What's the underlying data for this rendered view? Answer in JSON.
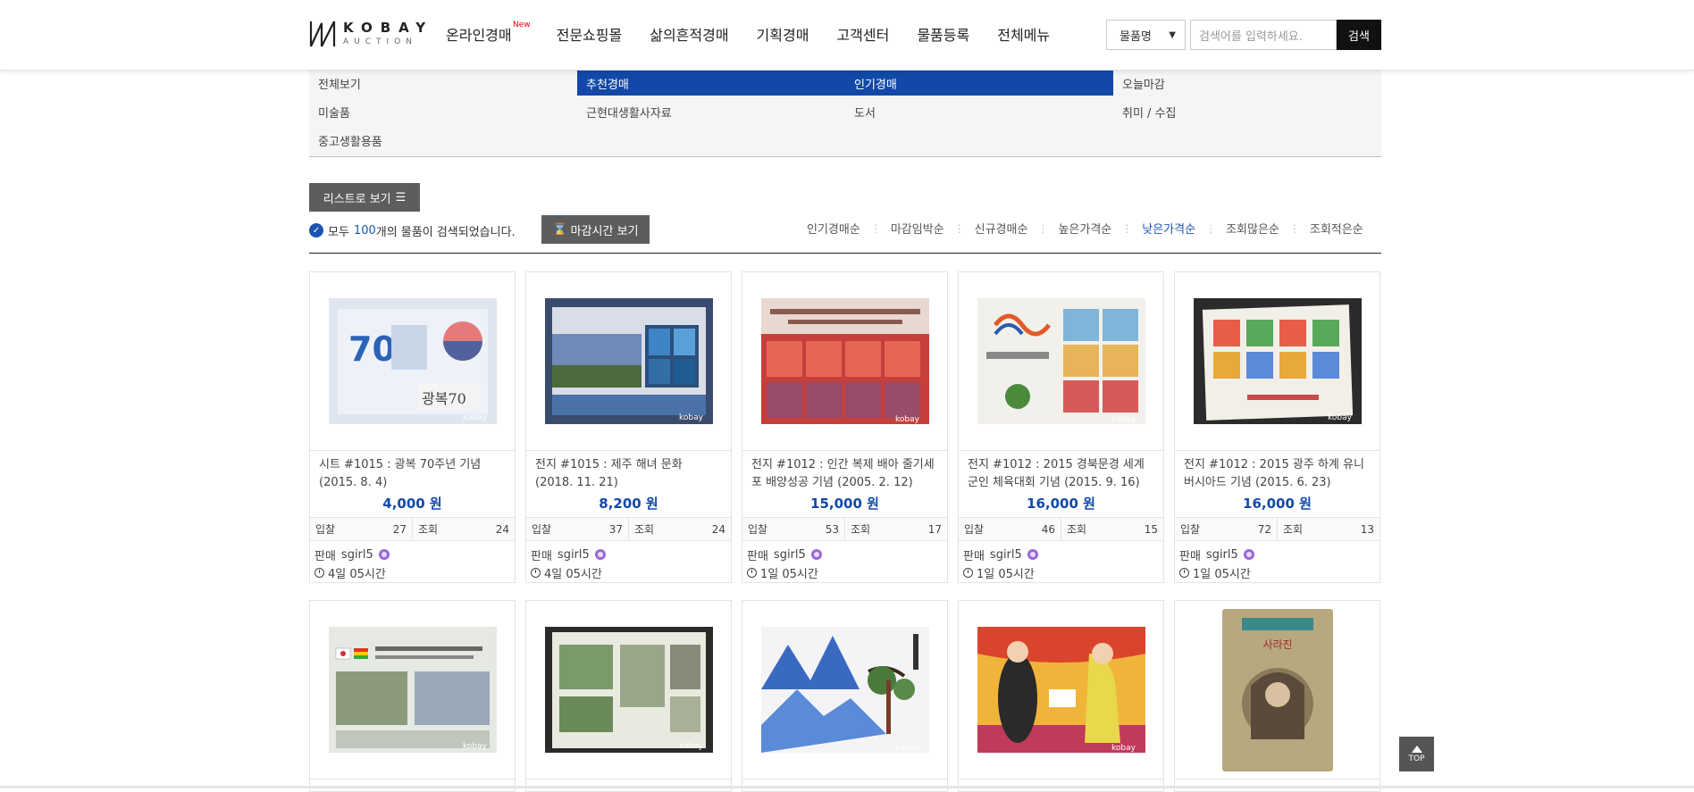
{
  "brand": {
    "name": "KOBAY",
    "sub": "AUCTION"
  },
  "gnb": {
    "items": [
      {
        "label": "온라인경매",
        "badge": "New"
      },
      {
        "label": "전문쇼핑몰"
      },
      {
        "label": "삶의흔적경매"
      },
      {
        "label": "기획경매"
      },
      {
        "label": "고객센터"
      },
      {
        "label": "물품등록"
      },
      {
        "label": "전체메뉴"
      }
    ]
  },
  "search": {
    "select_value": "물품명",
    "placeholder": "검색어를 입력하세요.",
    "button": "검색"
  },
  "categories": [
    {
      "label": "전체보기",
      "active": false
    },
    {
      "label": "추천경매",
      "active": true
    },
    {
      "label": "인기경매",
      "active": true
    },
    {
      "label": "오늘마감",
      "active": false
    },
    {
      "label": "미술품",
      "active": false
    },
    {
      "label": "근현대생활사자료",
      "active": false
    },
    {
      "label": "도서",
      "active": false
    },
    {
      "label": "취미 / 수집",
      "active": false
    },
    {
      "label": "중고생활용품",
      "active": false
    }
  ],
  "toolbar": {
    "list_view": "리스트로 보기",
    "count_prefix": "모두",
    "count_num": "100",
    "count_suffix": "개의 물품이 검색되었습니다.",
    "deadline_view": "마감시간 보기"
  },
  "sorts": [
    {
      "label": "인기경매순",
      "active": false
    },
    {
      "label": "마감임박순",
      "active": false
    },
    {
      "label": "신규경매순",
      "active": false
    },
    {
      "label": "높은가격순",
      "active": false
    },
    {
      "label": "낮은가격순",
      "active": true
    },
    {
      "label": "조회많은순",
      "active": false
    },
    {
      "label": "조회적은순",
      "active": false
    }
  ],
  "labels": {
    "bid": "입찰",
    "view": "조회",
    "seller": "판매"
  },
  "items": [
    {
      "title": "시트 #1015 : 광복 70주년 기념 (2015. 8. 4)",
      "price": "4,000 원",
      "bids": "27",
      "views": "24",
      "seller": "sgirl5",
      "remaining": "4일 05시간",
      "watermark": "kobay"
    },
    {
      "title": "전지 #1015 : 제주 해녀 문화 (2018. 11. 21)",
      "price": "8,200 원",
      "bids": "37",
      "views": "24",
      "seller": "sgirl5",
      "remaining": "4일 05시간",
      "watermark": "kobay"
    },
    {
      "title": "전지 #1012 : 인간 복제 배아 줄기세포 배양성공 기념 (2005. 2. 12)",
      "price": "15,000 원",
      "bids": "53",
      "views": "17",
      "seller": "sgirl5",
      "remaining": "1일 05시간",
      "watermark": "kobay"
    },
    {
      "title": "전지 #1012 : 2015 경북문경 세계군인 체육대회 기념 (2015. 9. 16)",
      "price": "16,000 원",
      "bids": "46",
      "views": "15",
      "seller": "sgirl5",
      "remaining": "1일 05시간",
      "watermark": "kobay"
    },
    {
      "title": "전지 #1012 : 2015 광주 하계 유니버시아드 기념 (2015. 6. 23)",
      "price": "16,000 원",
      "bids": "72",
      "views": "13",
      "seller": "sgirl5",
      "remaining": "1일 05시간",
      "watermark": "kobay"
    }
  ],
  "row2_watermarks": [
    "kobay",
    "kobay",
    "kobay",
    "kobay"
  ],
  "top_button": "TOP"
}
